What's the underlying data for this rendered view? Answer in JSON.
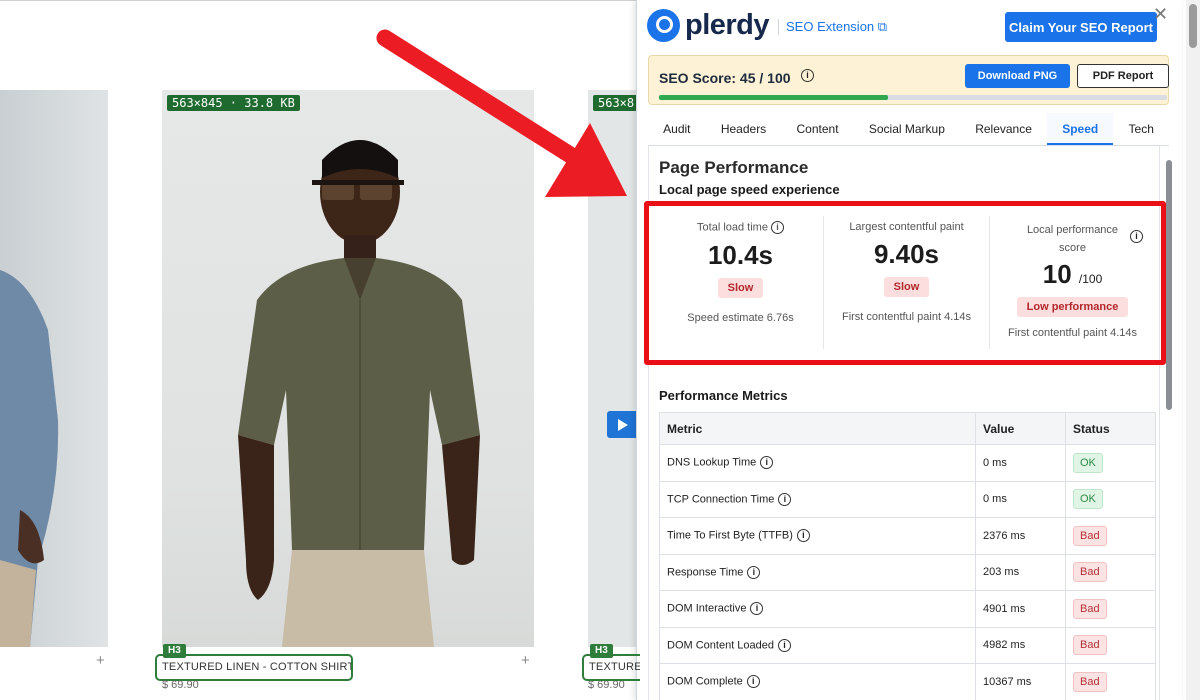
{
  "store": {
    "products": [
      {
        "size_badge": "",
        "heading_tag": "",
        "heading": "",
        "price": ""
      },
      {
        "size_badge": "563×845 · 33.8 KB",
        "heading_tag": "H3",
        "heading": "TEXTURED LINEN - COTTON SHIRT",
        "price": "$ 69.90"
      },
      {
        "size_badge": "563×8",
        "heading_tag": "H3",
        "heading": "TEXTURE",
        "price": "$ 69.90"
      }
    ],
    "add_icon": "plus-icon",
    "video_icon": "play-icon"
  },
  "extension": {
    "brand": "plerdy",
    "ext_link": "SEO Extension",
    "claim_button": "Claim Your SEO Report",
    "close_icon": "close-icon",
    "seo_score_label": "SEO Score: 45 / 100",
    "seo_score_value": 45,
    "seo_score_max": 100,
    "download_png": "Download PNG",
    "pdf_report": "PDF Report",
    "tabs": [
      {
        "label": "Audit",
        "active": false
      },
      {
        "label": "Headers",
        "active": false
      },
      {
        "label": "Content",
        "active": false
      },
      {
        "label": "Social Markup",
        "active": false
      },
      {
        "label": "Relevance",
        "active": false
      },
      {
        "label": "Speed",
        "active": true
      },
      {
        "label": "Tech",
        "active": false
      }
    ],
    "page_performance": {
      "title": "Page Performance",
      "subtitle": "Local page speed experience",
      "cards": [
        {
          "label": "Total load time",
          "value": "10.4s",
          "status": "Slow",
          "footer": "Speed estimate 6.76s"
        },
        {
          "label": "Largest contentful paint",
          "value": "9.40s",
          "status": "Slow",
          "footer": "First contentful paint 4.14s"
        },
        {
          "label": "Local performance score",
          "value": "10",
          "unit": "/100",
          "status": "Low performance",
          "footer": "First contentful paint 4.14s"
        }
      ]
    },
    "metrics": {
      "title": "Performance Metrics",
      "columns": [
        "Metric",
        "Value",
        "Status"
      ],
      "rows": [
        {
          "metric": "DNS Lookup Time",
          "value": "0 ms",
          "status": "OK"
        },
        {
          "metric": "TCP Connection Time",
          "value": "0 ms",
          "status": "OK"
        },
        {
          "metric": "Time To First Byte (TTFB)",
          "value": "2376 ms",
          "status": "Bad"
        },
        {
          "metric": "Response Time",
          "value": "203 ms",
          "status": "Bad"
        },
        {
          "metric": "DOM Interactive",
          "value": "4901 ms",
          "status": "Bad"
        },
        {
          "metric": "DOM Content Loaded",
          "value": "4982 ms",
          "status": "Bad"
        },
        {
          "metric": "DOM Complete",
          "value": "10367 ms",
          "status": "Bad"
        }
      ]
    },
    "colors": {
      "accent": "#1a73e8",
      "highlight": "#ea0f17",
      "ok": "#2e8a45",
      "bad": "#b53036"
    }
  }
}
